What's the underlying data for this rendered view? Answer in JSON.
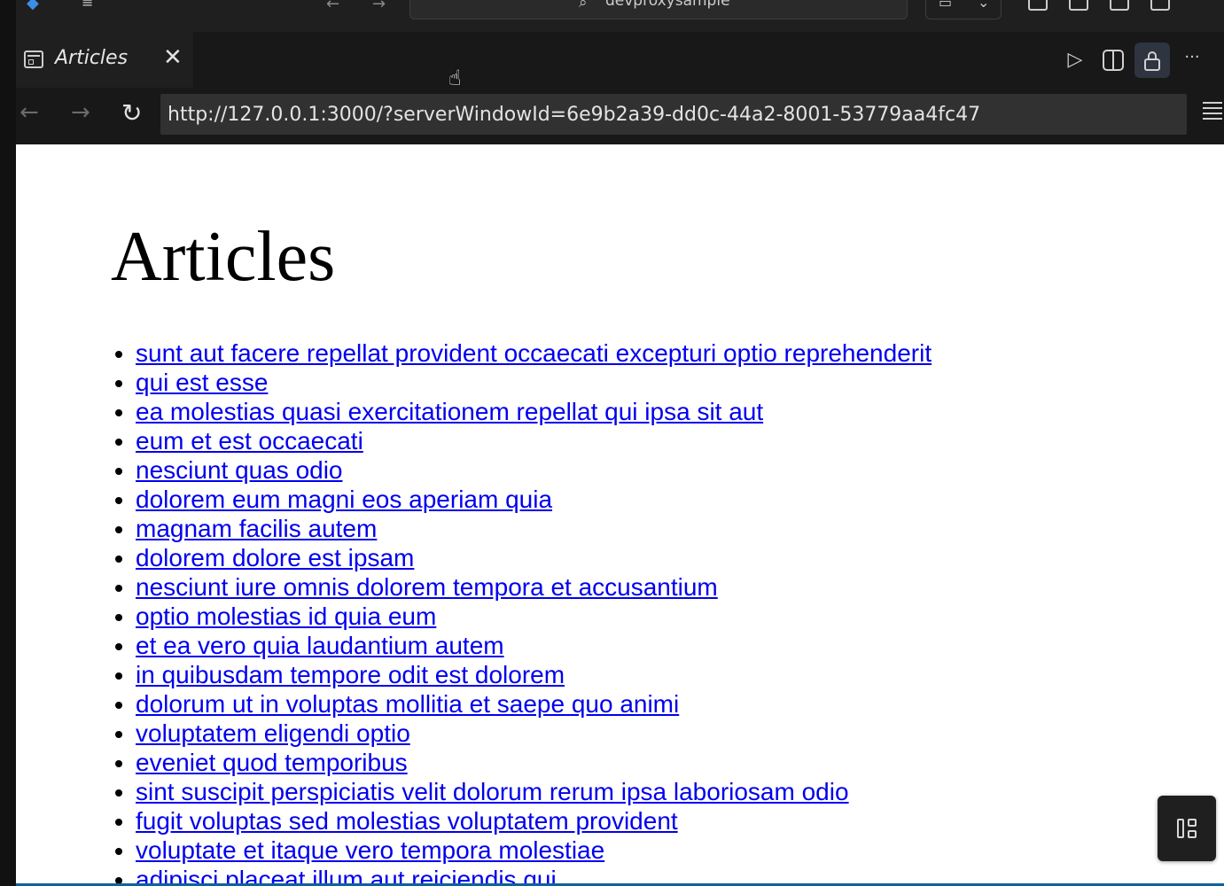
{
  "titlebar": {
    "search_icon": "search-icon",
    "command_center_text": "devproxysample"
  },
  "tab": {
    "label": "Articles",
    "close_glyph": "✕"
  },
  "nav": {
    "back_glyph": "←",
    "forward_glyph": "→",
    "reload_glyph": "↻",
    "url": "http://127.0.0.1:3000/?serverWindowId=6e9b2a39-dd0c-44a2-8001-53779aa4fc47"
  },
  "page": {
    "title": "Articles",
    "articles": [
      "sunt aut facere repellat provident occaecati excepturi optio reprehenderit",
      "qui est esse",
      "ea molestias quasi exercitationem repellat qui ipsa sit aut",
      "eum et est occaecati",
      "nesciunt quas odio",
      "dolorem eum magni eos aperiam quia",
      "magnam facilis autem",
      "dolorem dolore est ipsam",
      "nesciunt iure omnis dolorem tempora et accusantium",
      "optio molestias id quia eum",
      "et ea vero quia laudantium autem",
      "in quibusdam tempore odit est dolorem",
      "dolorum ut in voluptas mollitia et saepe quo animi",
      "voluptatem eligendi optio",
      "eveniet quod temporibus",
      "sint suscipit perspiciatis velit dolorum rerum ipsa laboriosam odio",
      "fugit voluptas sed molestias voluptatem provident",
      "voluptate et itaque vero tempora molestiae",
      "adipisci placeat illum aut reiciendis qui"
    ]
  },
  "colors": {
    "link": "#0000ee",
    "accent_border": "#0e639c",
    "chrome_bg": "#181818"
  }
}
